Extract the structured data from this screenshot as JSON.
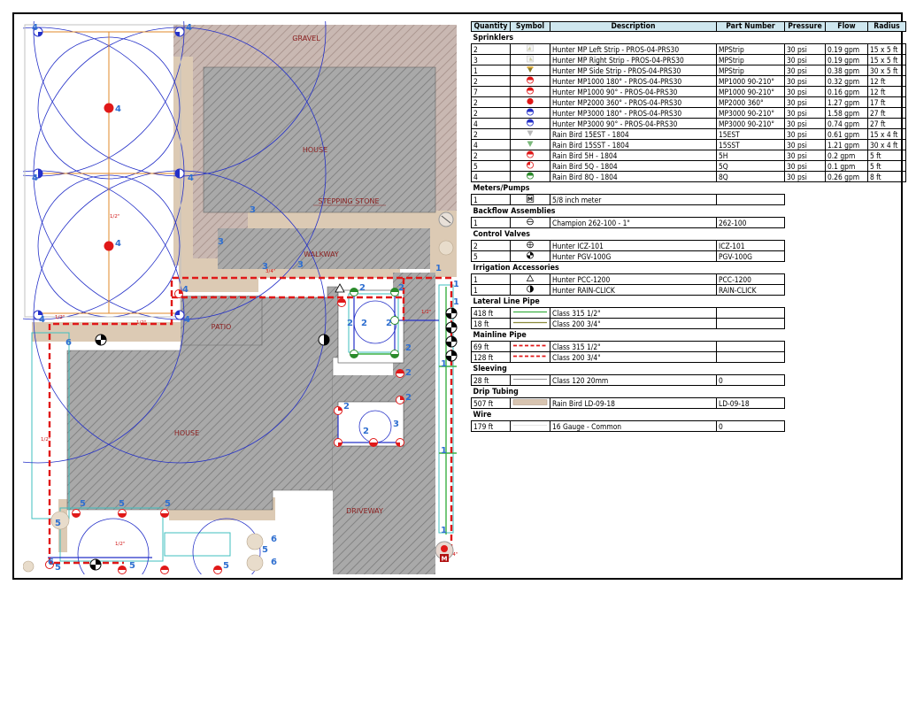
{
  "plan": {
    "areas": {
      "gravel": "GRAVEL",
      "house_top": "HOUSE",
      "house_main": "HOUSE",
      "stepping_stone": "STEPPING STONE",
      "walkway": "WALKWAY",
      "patio": "PATIO",
      "driveway": "DRIVEWAY"
    },
    "pipe_labels": {
      "a": "1/2\"",
      "b": "1/2\"",
      "c": "1/2\"",
      "d": "1/2\"",
      "e": "3/4\"",
      "f": "1/2\"",
      "g": "1/2\"",
      "h": "3/4\""
    },
    "zone_numbers": [
      "4",
      "4",
      "4",
      "4",
      "4",
      "4",
      "4",
      "4",
      "4",
      "3",
      "3",
      "3",
      "3",
      "2",
      "2",
      "2",
      "2",
      "2",
      "2",
      "2",
      "2",
      "2",
      "2",
      "1",
      "1",
      "1",
      "1",
      "1",
      "1",
      "6",
      "6",
      "6",
      "6",
      "5",
      "5",
      "5",
      "5",
      "5",
      "5",
      "5",
      "5",
      "3",
      "3",
      "3"
    ],
    "meter_glyph": "M"
  },
  "legend": {
    "headers": {
      "quantity": "Quantity",
      "symbol": "Symbol",
      "description": "Description",
      "part_number": "Part Number",
      "pressure": "Pressure",
      "flow": "Flow",
      "radius": "Radius"
    },
    "sprinklers_title": "Sprinklers",
    "sprinklers": [
      {
        "qty": "2",
        "sym": "strip-left",
        "desc": "Hunter MP Left Strip - PROS-04-PRS30",
        "part": "MPStrip",
        "pressure": "30 psi",
        "flow": "0.19 gpm",
        "radius": "15 x 5 ft"
      },
      {
        "qty": "3",
        "sym": "strip-right",
        "desc": "Hunter MP Right Strip - PROS-04-PRS30",
        "part": "MPStrip",
        "pressure": "30 psi",
        "flow": "0.19 gpm",
        "radius": "15 x 5 ft"
      },
      {
        "qty": "1",
        "sym": "strip-side",
        "desc": "Hunter MP Side Strip - PROS-04-PRS30",
        "part": "MPStrip",
        "pressure": "30 psi",
        "flow": "0.38 gpm",
        "radius": "30 x 5 ft"
      },
      {
        "qty": "2",
        "sym": "half-red",
        "desc": "Hunter MP1000 180° - PROS-04-PRS30",
        "part": "MP1000 90-210°",
        "pressure": "30 psi",
        "flow": "0.32 gpm",
        "radius": "12 ft"
      },
      {
        "qty": "7",
        "sym": "quarter-red",
        "desc": "Hunter MP1000 90° - PROS-04-PRS30",
        "part": "MP1000 90-210°",
        "pressure": "30 psi",
        "flow": "0.16 gpm",
        "radius": "12 ft"
      },
      {
        "qty": "2",
        "sym": "full-red",
        "desc": "Hunter MP2000 360° - PROS-04-PRS30",
        "part": "MP2000 360°",
        "pressure": "30 psi",
        "flow": "1.27 gpm",
        "radius": "17 ft"
      },
      {
        "qty": "2",
        "sym": "half-blue",
        "desc": "Hunter MP3000 180° - PROS-04-PRS30",
        "part": "MP3000 90-210°",
        "pressure": "30 psi",
        "flow": "1.58 gpm",
        "radius": "27 ft"
      },
      {
        "qty": "4",
        "sym": "quarter-blue",
        "desc": "Hunter MP3000 90° - PROS-04-PRS30",
        "part": "MP3000 90-210°",
        "pressure": "30 psi",
        "flow": "0.74 gpm",
        "radius": "27 ft"
      },
      {
        "qty": "2",
        "sym": "tri-gray",
        "desc": "Rain Bird 15EST - 1804",
        "part": "15EST",
        "pressure": "30 psi",
        "flow": "0.61 gpm",
        "radius": "15 x 4 ft"
      },
      {
        "qty": "4",
        "sym": "tri-green",
        "desc": "Rain Bird 15SST - 1804",
        "part": "15SST",
        "pressure": "30 psi",
        "flow": "1.21 gpm",
        "radius": "30 x 4 ft"
      },
      {
        "qty": "2",
        "sym": "half-red-small",
        "desc": "Rain Bird 5H - 1804",
        "part": "5H",
        "pressure": "30 psi",
        "flow": "0.2 gpm",
        "radius": "5 ft"
      },
      {
        "qty": "5",
        "sym": "quarter-red-small",
        "desc": "Rain Bird 5Q - 1804",
        "part": "5Q",
        "pressure": "30 psi",
        "flow": "0.1 gpm",
        "radius": "5 ft"
      },
      {
        "qty": "4",
        "sym": "quarter-green",
        "desc": "Rain Bird 8Q - 1804",
        "part": "8Q",
        "pressure": "30 psi",
        "flow": "0.26 gpm",
        "radius": "8 ft"
      }
    ],
    "meters_title": "Meters/Pumps",
    "meters": [
      {
        "qty": "1",
        "sym": "meter",
        "glyph": "M",
        "desc": "5/8 inch meter",
        "part": ""
      }
    ],
    "backflow_title": "Backflow Assemblies",
    "backflow": [
      {
        "qty": "1",
        "sym": "backflow",
        "desc": "Champion 262-100 - 1\"",
        "part": "262-100"
      }
    ],
    "valves_title": "Control Valves",
    "valves": [
      {
        "qty": "2",
        "sym": "valve-icz",
        "desc": "Hunter ICZ-101",
        "part": "ICZ-101"
      },
      {
        "qty": "5",
        "sym": "valve-pgv",
        "desc": "Hunter PGV-100G",
        "part": "PGV-100G"
      }
    ],
    "accessories_title": "Irrigation Accessories",
    "accessories": [
      {
        "qty": "1",
        "sym": "pcc",
        "desc": "Hunter PCC-1200",
        "part": "PCC-1200"
      },
      {
        "qty": "1",
        "sym": "rainclick",
        "desc": "Hunter RAIN-CLICK",
        "part": "RAIN-CLICK"
      }
    ],
    "lateral_title": "Lateral Line Pipe",
    "lateral": [
      {
        "qty": "418 ft",
        "sym": "line-green",
        "desc": "Class 315 1/2\"",
        "part": ""
      },
      {
        "qty": "18 ft",
        "sym": "line-olive",
        "desc": "Class 200 3/4\"",
        "part": ""
      }
    ],
    "mainline_title": "Mainline Pipe",
    "mainline": [
      {
        "qty": "69 ft",
        "sym": "dash-red",
        "desc": "Class 315 1/2\"",
        "part": ""
      },
      {
        "qty": "128 ft",
        "sym": "dash-red",
        "desc": "Class 200 3/4\"",
        "part": ""
      }
    ],
    "sleeving_title": "Sleeving",
    "sleeving": [
      {
        "qty": "28 ft",
        "sym": "line-gray",
        "desc": "Class 120 20mm",
        "part": "0"
      }
    ],
    "drip_title": "Drip Tubing",
    "drip": [
      {
        "qty": "507 ft",
        "sym": "drip",
        "desc": "Rain Bird LD-09-18",
        "part": "LD-09-18"
      }
    ],
    "wire_title": "Wire",
    "wire": [
      {
        "qty": "179 ft",
        "sym": "line-thin",
        "desc": "16 Gauge - Common",
        "part": "0"
      }
    ],
    "colors": {
      "header_bg": "#cfe7ef",
      "mainline": "#e01818",
      "lateral": "#3cb043",
      "zone_number": "#2f6fd0",
      "head_blue": "#2430c8",
      "head_red": "#e01818"
    }
  }
}
